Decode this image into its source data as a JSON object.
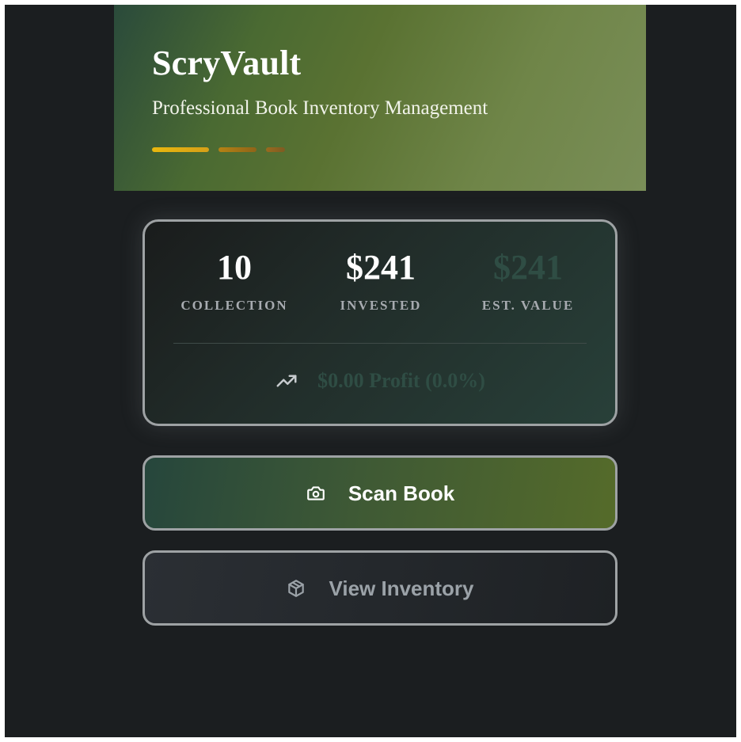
{
  "header": {
    "title": "ScryVault",
    "subtitle": "Professional Book Inventory Management"
  },
  "stats": {
    "collection": {
      "value": "10",
      "label": "COLLECTION"
    },
    "invested": {
      "value": "$241",
      "label": "INVESTED"
    },
    "est_value": {
      "value": "$241",
      "label": "EST. VALUE"
    }
  },
  "profit": {
    "icon": "trending-up-icon",
    "text": "$0.00 Profit (0.0%)"
  },
  "actions": {
    "scan": {
      "label": "Scan Book",
      "icon": "camera-icon"
    },
    "inventory": {
      "label": "View Inventory",
      "icon": "package-icon"
    }
  },
  "colors": {
    "background": "#1b1e20",
    "hero_start": "#2a4a3b",
    "hero_end": "#7a8e58",
    "accent_gold": "#e8b70e",
    "muted_value": "#2f4d44",
    "border": "#9ea2a4"
  }
}
